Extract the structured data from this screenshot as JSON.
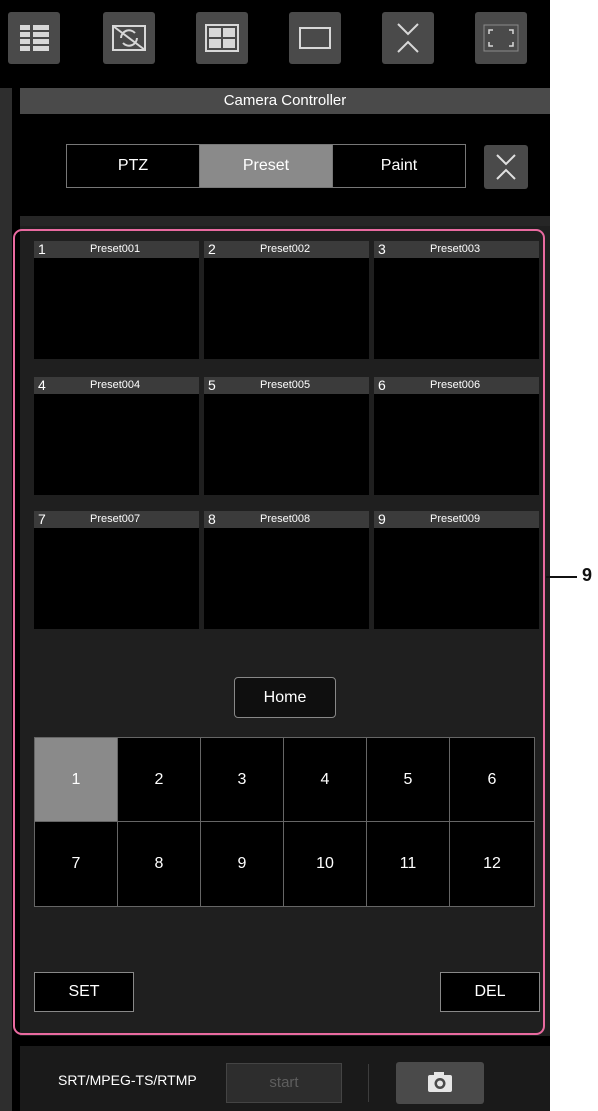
{
  "toolbar": {
    "icons": [
      "list-view-icon",
      "no-image-icon",
      "quad-view-icon",
      "single-view-icon",
      "collapse-icon",
      "fullscreen-icon"
    ]
  },
  "header": {
    "title": "Camera Controller"
  },
  "mode_tabs": [
    {
      "label": "PTZ",
      "active": false
    },
    {
      "label": "Preset",
      "active": true
    },
    {
      "label": "Paint",
      "active": false
    }
  ],
  "presets": [
    {
      "number": "1",
      "name": "Preset001"
    },
    {
      "number": "2",
      "name": "Preset002"
    },
    {
      "number": "3",
      "name": "Preset003"
    },
    {
      "number": "4",
      "name": "Preset004"
    },
    {
      "number": "5",
      "name": "Preset005"
    },
    {
      "number": "6",
      "name": "Preset006"
    },
    {
      "number": "7",
      "name": "Preset007"
    },
    {
      "number": "8",
      "name": "Preset008"
    },
    {
      "number": "9",
      "name": "Preset009"
    }
  ],
  "home_label": "Home",
  "number_buttons": [
    "1",
    "2",
    "3",
    "4",
    "5",
    "6",
    "7",
    "8",
    "9",
    "10",
    "11",
    "12"
  ],
  "selected_number": "1",
  "set_label": "SET",
  "del_label": "DEL",
  "bottom": {
    "stream_label": "SRT/MPEG-TS/RTMP",
    "start_label": "start"
  },
  "callout": {
    "label": "9"
  },
  "colors": {
    "highlight": "#e96aa0",
    "active_tab": "#8a8a8a",
    "background": "#000000"
  }
}
